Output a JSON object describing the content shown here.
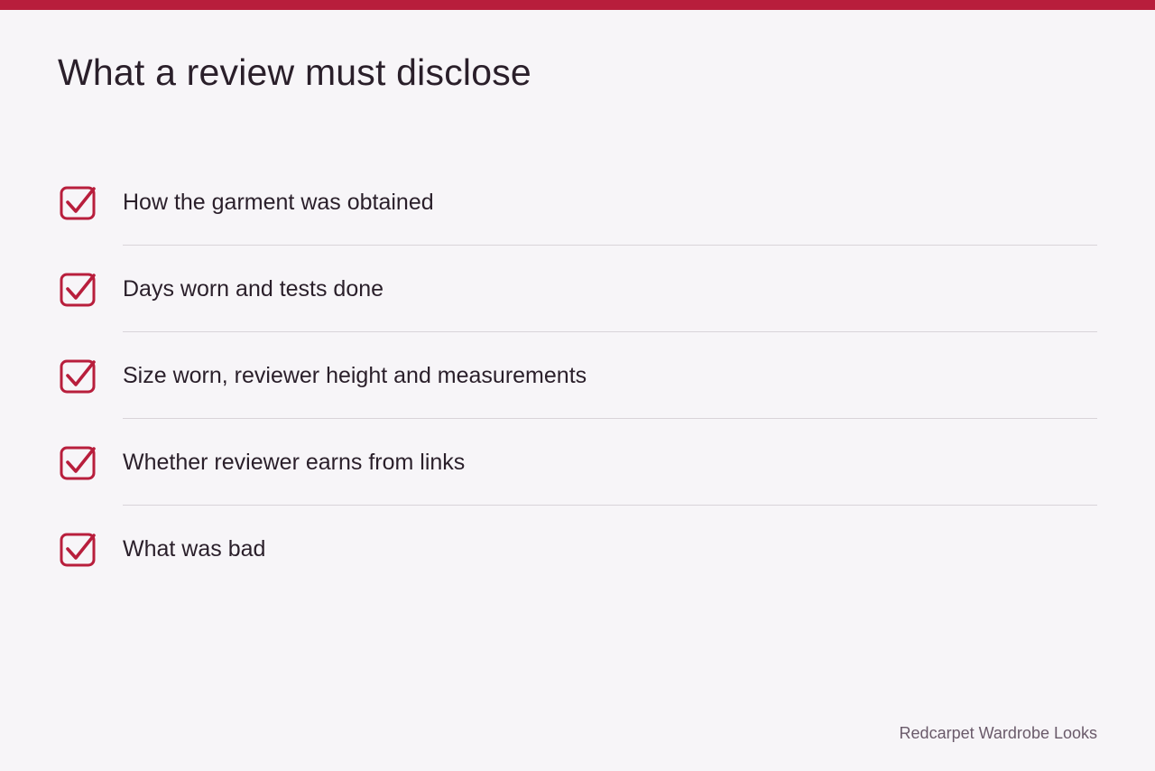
{
  "page": {
    "title": "What a review must disclose",
    "accent_color": "#b81e3c"
  },
  "checklist": {
    "items": [
      {
        "label": "How the garment was obtained",
        "checked": true,
        "icon": "checkbox-checked-icon"
      },
      {
        "label": "Days worn and tests done",
        "checked": true,
        "icon": "checkbox-checked-icon"
      },
      {
        "label": "Size worn, reviewer height and measurements",
        "checked": true,
        "icon": "checkbox-checked-icon"
      },
      {
        "label": "Whether reviewer earns from links",
        "checked": true,
        "icon": "checkbox-checked-icon"
      },
      {
        "label": "What was bad",
        "checked": true,
        "icon": "checkbox-checked-icon"
      }
    ]
  },
  "footer": {
    "brand": "Redcarpet Wardrobe Looks"
  }
}
